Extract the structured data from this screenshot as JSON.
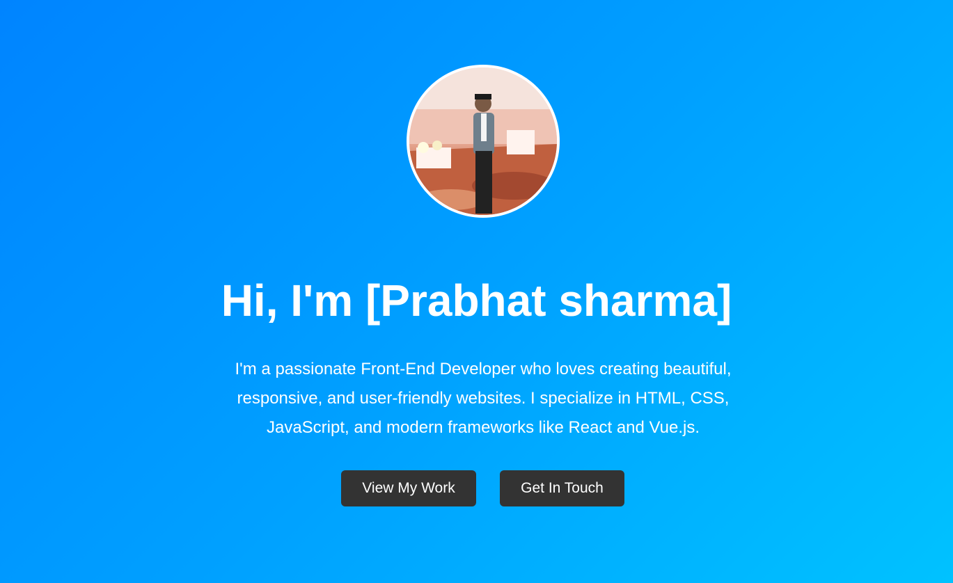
{
  "hero": {
    "title": "Hi, I'm [Prabhat sharma]",
    "bio": "I'm a passionate Front-End Developer who loves creating beautiful, responsive, and user-friendly websites. I specialize in HTML, CSS, JavaScript, and modern frameworks like React and Vue.js.",
    "buttons": [
      {
        "label": "View My Work"
      },
      {
        "label": "Get In Touch"
      }
    ]
  },
  "colors": {
    "gradient_start": "#0084ff",
    "gradient_end": "#00c2ff",
    "button_bg": "#333333"
  }
}
